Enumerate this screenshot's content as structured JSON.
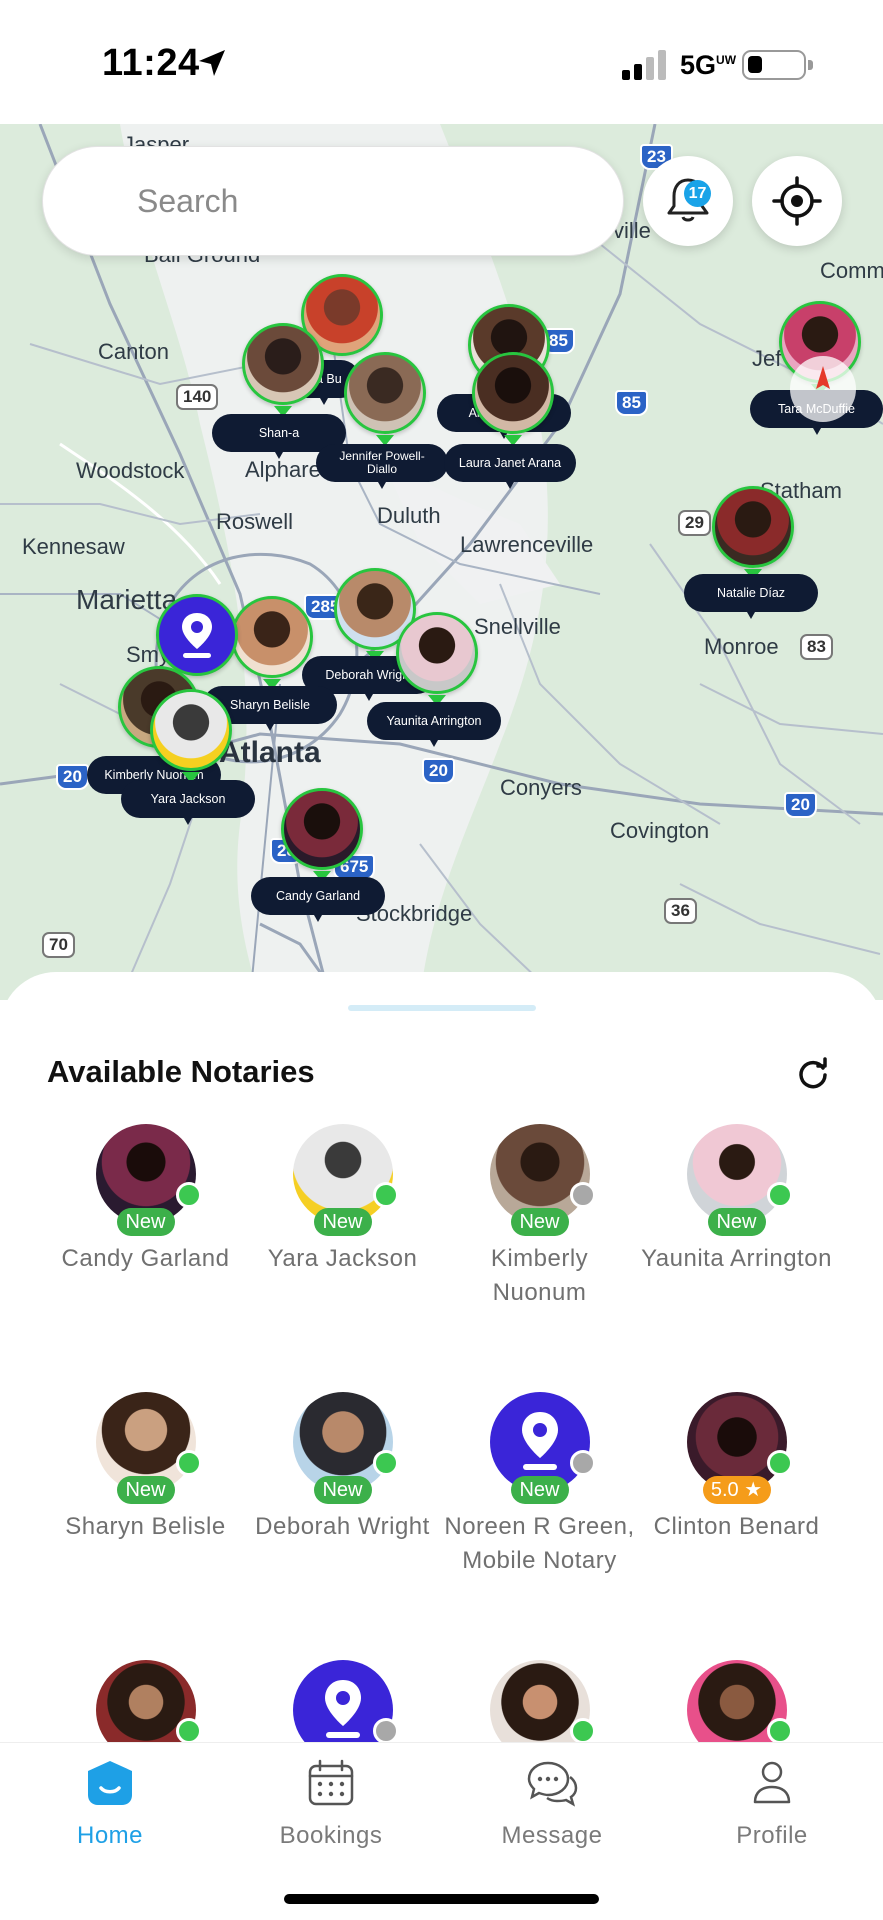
{
  "status_bar": {
    "time": "11:24",
    "network": "5G",
    "network_suffix": "UW"
  },
  "search": {
    "placeholder": "Search"
  },
  "notifications": {
    "count": "17"
  },
  "colors": {
    "accent": "#1ea0e6",
    "online": "#3cc851",
    "offline": "#a8a8a8",
    "new_badge": "#3cb04a",
    "rating_badge": "#f59c1a",
    "pin_label_bg": "#0f1b33"
  },
  "map": {
    "cities": {
      "jasper": "Jasper",
      "ball_ground": "Ball Ground",
      "canton": "Canton",
      "woodstock": "Woodstock",
      "alpharetta": "Alpharet",
      "roswell": "Roswell",
      "duluth": "Duluth",
      "lawrenceville": "Lawrenceville",
      "kennesaw": "Kennesaw",
      "marietta": "Marietta",
      "smyrna": "Smy",
      "atlanta": "Atlanta",
      "snellville": "Snellville",
      "conyers": "Conyers",
      "covington": "Covington",
      "stockbridge": "Stockbridge",
      "monroe": "Monroe",
      "statham": "Statham",
      "jefferson": "Jef",
      "commerce": "Comm",
      "gainesville": "ville"
    },
    "shields": {
      "i575_north": "23",
      "r140": "140",
      "i85_a": "85",
      "i85_b": "85",
      "r29": "29",
      "r83": "83",
      "i285": "285",
      "i20_w": "20",
      "i20_c": "20",
      "i20_e": "20",
      "i675": "675",
      "r36": "36",
      "r70": "70",
      "i285_s": "28"
    },
    "pins": [
      {
        "name": "Shan-a",
        "icon": "avatar"
      },
      {
        "name": "Jennifer Powell-Diallo",
        "icon": "avatar"
      },
      {
        "name": "Laura Janet Arana",
        "icon": "avatar"
      },
      {
        "name": "Abercrombie",
        "icon": "avatar"
      },
      {
        "name": "Tara McDuffie",
        "icon": "avatar"
      },
      {
        "name": "Natalie Díaz",
        "icon": "avatar"
      },
      {
        "name": "Deborah Wright",
        "icon": "avatar"
      },
      {
        "name": "Sharyn Belisle",
        "icon": "avatar"
      },
      {
        "name": "Yaunita Arrington",
        "icon": "avatar"
      },
      {
        "name": "Kimberly Nuonum",
        "icon": "avatar"
      },
      {
        "name": "Yara Jackson",
        "icon": "avatar"
      },
      {
        "name": "Candy Garland",
        "icon": "avatar"
      },
      {
        "name": "Noreen R Green, Mobile Notary",
        "icon": "location-pin-icon"
      },
      {
        "name": "nia Bu",
        "icon": "avatar"
      }
    ]
  },
  "sheet": {
    "title": "Available Notaries",
    "notaries": [
      {
        "name": "Candy Garland",
        "badge": "New",
        "online": true
      },
      {
        "name": "Yara Jackson",
        "badge": "New",
        "online": true
      },
      {
        "name": "Kimberly Nuonum",
        "badge": "New",
        "online": false
      },
      {
        "name": "Yaunita Arrington",
        "badge": "New",
        "online": true
      },
      {
        "name": "Sharyn Belisle",
        "badge": "New",
        "online": true
      },
      {
        "name": "Deborah Wright",
        "badge": "New",
        "online": true
      },
      {
        "name": "Noreen R Green, Mobile Notary",
        "badge": "New",
        "online": false
      },
      {
        "name": "Clinton Benard",
        "badge": "5.0 ★",
        "online": true
      }
    ]
  },
  "tabs": {
    "home": "Home",
    "bookings": "Bookings",
    "message": "Message",
    "profile": "Profile"
  }
}
